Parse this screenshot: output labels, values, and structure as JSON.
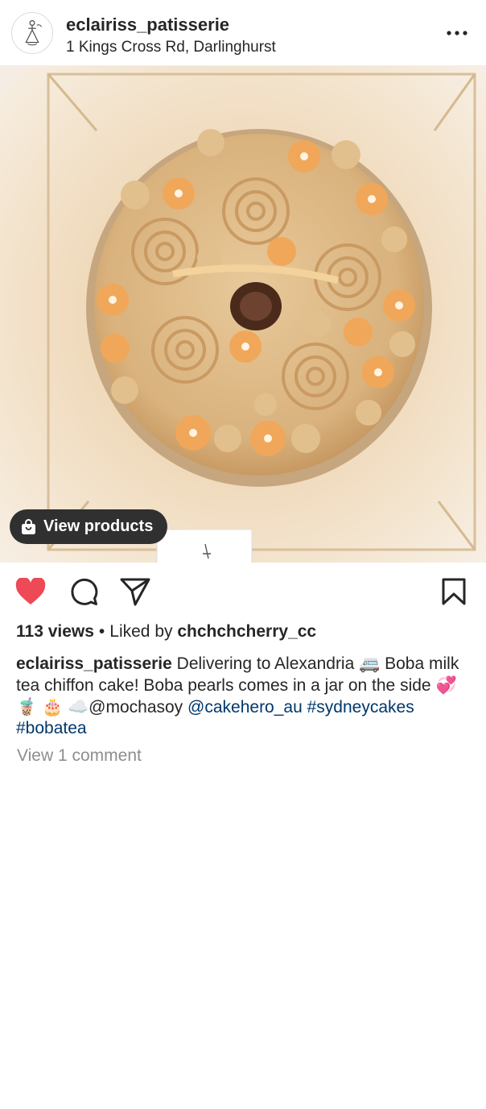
{
  "header": {
    "username": "eclairiss_patisserie",
    "location": "1 Kings Cross Rd, Darlinghurst",
    "more_icon": "more-horizontal-icon"
  },
  "media": {
    "description_icon": "cake-photo",
    "view_products_label": "View products",
    "bag_icon": "shopping-bag-icon"
  },
  "actions": {
    "like_icon": "heart-filled-icon",
    "like_color": "#ed4956",
    "comment_icon": "comment-icon",
    "share_icon": "send-icon",
    "save_icon": "bookmark-icon"
  },
  "stats": {
    "views": "113 views",
    "separator": "•",
    "liked_by_prefix": "Liked by",
    "liked_by_user": "chchchcherry_cc"
  },
  "caption": {
    "username": "eclairiss_patisserie",
    "text_1": "Delivering to Alexandria",
    "emoji_van": "🚐",
    "text_2": "Boba milk tea chiffon cake! Boba pearls comes in a jar on the side",
    "emoji_hearts": "💞",
    "emoji_tea": "🧋",
    "emoji_cake": "🎂",
    "emoji_cloud": "☁️",
    "mention_1": "@mochasoy",
    "mention_2": "@cakehero_au",
    "hashtag_1": "#sydneycakes",
    "hashtag_2": "#bobatea"
  },
  "comments": {
    "view_label": "View 1 comment"
  },
  "colors": {
    "link": "#00376b",
    "muted": "#8e8e8e",
    "text": "#262626",
    "pill_bg": "#303030"
  }
}
